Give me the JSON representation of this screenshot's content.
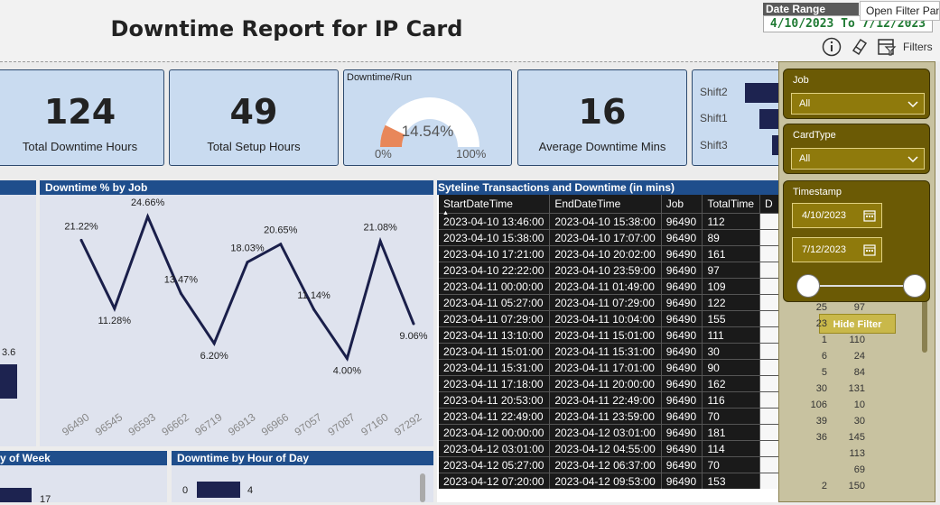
{
  "header": {
    "title": "Downtime Report for IP Card",
    "date_range_label": "Date Range",
    "date_range_value": "4/10/2023 To 7/12/2023",
    "tooltip": "Open Filter Pane",
    "filters_label": "Filters"
  },
  "kpis": [
    {
      "value": "124",
      "label": "Total Downtime Hours"
    },
    {
      "value": "49",
      "label": "Total Setup Hours"
    },
    {
      "value": "16",
      "label": "Average Downtime Mins"
    }
  ],
  "gauge": {
    "title": "Downtime/Run",
    "value": "14.54%",
    "min": "0%",
    "max": "100%",
    "fraction": 0.1454
  },
  "shift_chart": {
    "labels": [
      "Shift2",
      "Shift1",
      "Shift3"
    ]
  },
  "partial_chart": {
    "value_label": "3.6"
  },
  "downtime_by_job": {
    "title": "Downtime % by Job"
  },
  "chart_data": {
    "type": "line",
    "title": "Downtime % by Job",
    "categories": [
      "96490",
      "96545",
      "96593",
      "96662",
      "96719",
      "96913",
      "96966",
      "97057",
      "97087",
      "97160",
      "97292"
    ],
    "values": [
      21.22,
      11.28,
      24.66,
      13.47,
      6.2,
      18.03,
      20.65,
      11.14,
      4.0,
      21.08,
      9.06
    ],
    "labels": [
      "21.22%",
      "11.28%",
      "24.66%",
      "13.47%",
      "6.20%",
      "18.03%",
      "20.65%",
      "11.14%",
      "4.00%",
      "21.08%",
      "9.06%"
    ],
    "ylim": [
      0,
      26
    ],
    "grid": false,
    "color": "#1a1f4a"
  },
  "table": {
    "title": "Syteline Transactions and Downtime (in mins)",
    "columns": [
      "StartDateTime",
      "EndDateTime",
      "Job",
      "TotalTime",
      "D"
    ],
    "rows": [
      [
        "2023-04-10 13:46:00",
        "2023-04-10 15:38:00",
        "96490",
        "112"
      ],
      [
        "2023-04-10 15:38:00",
        "2023-04-10 17:07:00",
        "96490",
        "89"
      ],
      [
        "2023-04-10 17:21:00",
        "2023-04-10 20:02:00",
        "96490",
        "161"
      ],
      [
        "2023-04-10 22:22:00",
        "2023-04-10 23:59:00",
        "96490",
        "97"
      ],
      [
        "2023-04-11 00:00:00",
        "2023-04-11 01:49:00",
        "96490",
        "109"
      ],
      [
        "2023-04-11 05:27:00",
        "2023-04-11 07:29:00",
        "96490",
        "122"
      ],
      [
        "2023-04-11 07:29:00",
        "2023-04-11 10:04:00",
        "96490",
        "155"
      ],
      [
        "2023-04-11 13:10:00",
        "2023-04-11 15:01:00",
        "96490",
        "111"
      ],
      [
        "2023-04-11 15:01:00",
        "2023-04-11 15:31:00",
        "96490",
        "30"
      ],
      [
        "2023-04-11 15:31:00",
        "2023-04-11 17:01:00",
        "96490",
        "90"
      ],
      [
        "2023-04-11 17:18:00",
        "2023-04-11 20:00:00",
        "96490",
        "162"
      ],
      [
        "2023-04-11 20:53:00",
        "2023-04-11 22:49:00",
        "96490",
        "116"
      ],
      [
        "2023-04-11 22:49:00",
        "2023-04-11 23:59:00",
        "96490",
        "70"
      ],
      [
        "2023-04-12 00:00:00",
        "2023-04-12 03:01:00",
        "96490",
        "181"
      ],
      [
        "2023-04-12 03:01:00",
        "2023-04-12 04:55:00",
        "96490",
        "114"
      ],
      [
        "2023-04-12 05:27:00",
        "2023-04-12 06:37:00",
        "96490",
        "70"
      ],
      [
        "2023-04-12 07:20:00",
        "2023-04-12 09:53:00",
        "96490",
        "153"
      ]
    ],
    "extra_cols": [
      [
        "25",
        "97"
      ],
      [
        "23",
        ""
      ],
      [
        "1",
        "110"
      ],
      [
        "6",
        "24"
      ],
      [
        "5",
        "84"
      ],
      [
        "30",
        "131"
      ],
      [
        "106",
        "10"
      ],
      [
        "39",
        "30"
      ],
      [
        "36",
        "145"
      ],
      [
        "",
        "113"
      ],
      [
        "",
        "69"
      ],
      [
        "2",
        "150"
      ]
    ]
  },
  "bottom": {
    "left_title": "y of Week",
    "left_value": "17",
    "right_title": "Downtime by Hour of Day",
    "hour_label": "0",
    "hour_value": "4"
  },
  "filters": {
    "job_label": "Job",
    "job_value": "All",
    "cardtype_label": "CardType",
    "cardtype_value": "All",
    "timestamp_label": "Timestamp",
    "start_date": "4/10/2023",
    "end_date": "7/12/2023",
    "hide_label": "Hide Filter"
  }
}
